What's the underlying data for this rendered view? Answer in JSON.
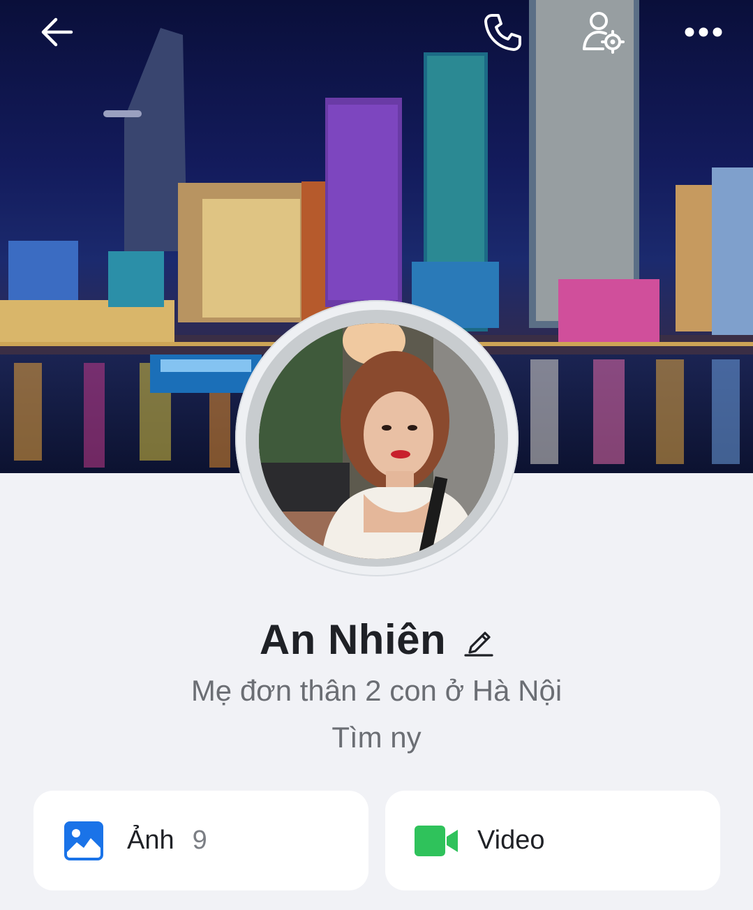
{
  "header": {
    "back_icon": "arrow-left-icon",
    "call_icon": "phone-icon",
    "settings_icon": "user-settings-icon",
    "more_icon": "more-horizontal-icon"
  },
  "cover": {
    "description_icon": "cover-photo"
  },
  "profile": {
    "name": "An Nhiên",
    "bio_line1": "Mẹ đơn thân 2 con ở Hà Nội",
    "bio_line2": "Tìm ny"
  },
  "media": {
    "photos_label": "Ảnh",
    "photos_count": "9",
    "video_label": "Video"
  },
  "colors": {
    "photo_icon": "#1a73e8",
    "video_icon": "#2fc25b",
    "background": "#f1f2f6"
  }
}
